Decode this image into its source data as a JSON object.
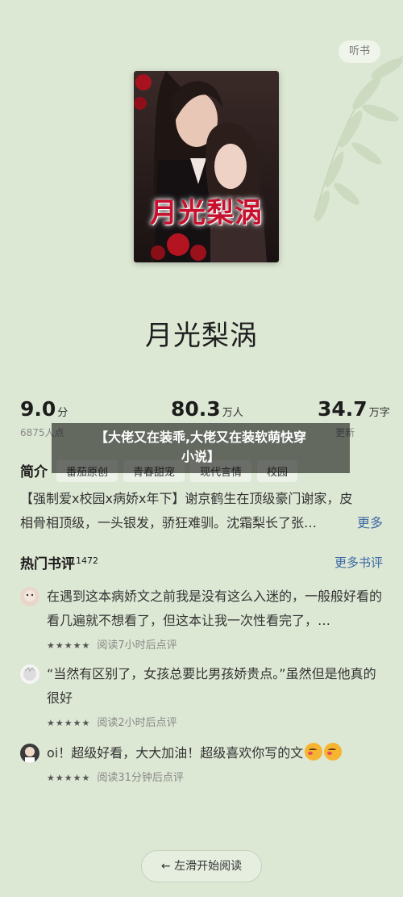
{
  "header": {
    "listen_label": "听书"
  },
  "cover": {
    "title_art": "月光梨涡"
  },
  "book": {
    "title": "月光梨涡"
  },
  "stats": {
    "rating": {
      "value": "9.0",
      "unit": "分",
      "sub": "6875人点"
    },
    "readers": {
      "value": "80.3",
      "unit": "万人",
      "sub": ""
    },
    "words": {
      "value": "34.7",
      "unit": "万字",
      "sub": "更新"
    }
  },
  "tags": {
    "label": "简介",
    "items": [
      "番茄原创",
      "青春甜宠",
      "现代言情",
      "校园"
    ]
  },
  "intro": {
    "line1": "【强制爱x校园x病娇x年下】谢京鹤生在顶级豪门谢家，皮",
    "line2": "相骨相顶级，一头银发，骄狂难驯。沈霜梨长了张…",
    "more": "更多"
  },
  "hot_reviews": {
    "title": "热门书评",
    "count": "1472",
    "more": "更多书评",
    "items": [
      {
        "text": "在遇到这本病娇文之前我是没有这么入迷的，一般般好看的看几遍就不想看了，但这本让我一次性看完了，…",
        "stars": "★★★★★",
        "meta": "阅读7小时后点评"
      },
      {
        "text": "“当然有区别了，女孩总要比男孩娇贵点。”虽然但是他真的很好",
        "stars": "★★★★★",
        "meta": "阅读2小时后点评"
      },
      {
        "text": "oi！超级好看，大大加油！超级喜欢你写的文",
        "stars": "★★★★★",
        "meta": "阅读31分钟后点评"
      }
    ]
  },
  "footer": {
    "start_label": "← 左滑开始阅读"
  },
  "overlay": {
    "line1": "【大佬又在装乖,大佬又在装软萌快穿",
    "line2": "小说】"
  },
  "colors": {
    "background": "#dde8d4",
    "link": "#3d6aa6",
    "cover_title": "#c8102e"
  }
}
